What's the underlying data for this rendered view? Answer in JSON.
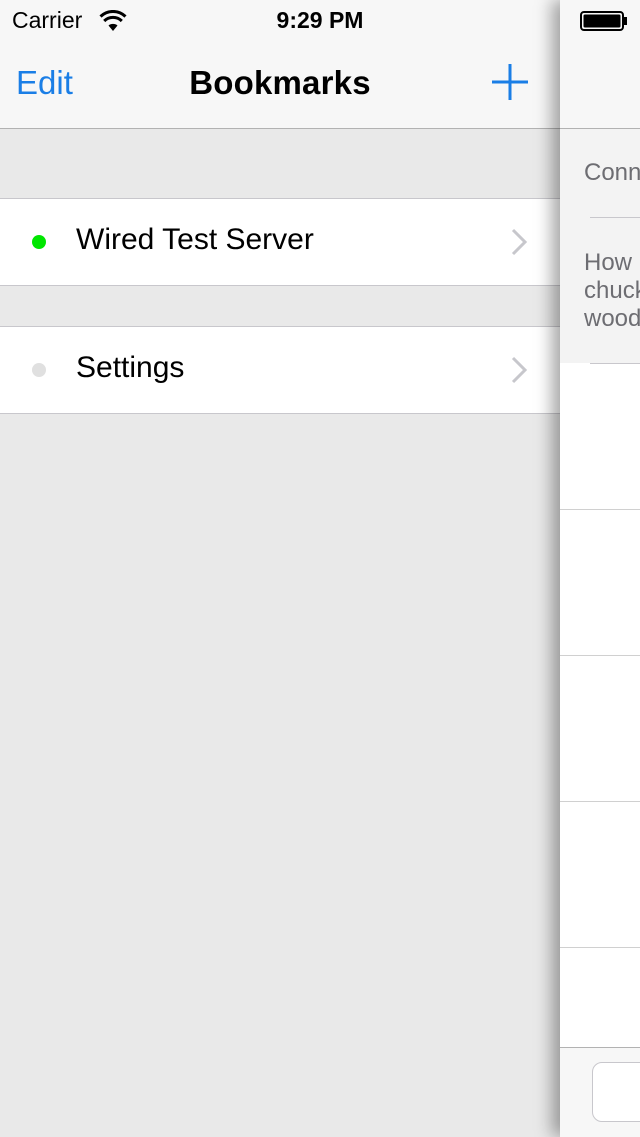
{
  "status_bar": {
    "carrier": "Carrier",
    "time": "9:29 PM"
  },
  "nav": {
    "edit_label": "Edit",
    "title": "Bookmarks",
    "add_icon": "plus-icon"
  },
  "bookmarks": [
    {
      "label": "Wired Test Server",
      "status_color": "#00e600"
    }
  ],
  "settings": {
    "label": "Settings",
    "status_color": "#e0e0e0"
  },
  "detail_pane": {
    "info_line_1": "Conn",
    "info_line_2": "How",
    "info_line_3": "chuck",
    "info_line_4": "wood"
  },
  "colors": {
    "accent": "#1a7ee6",
    "background": "#e9e9e9"
  }
}
